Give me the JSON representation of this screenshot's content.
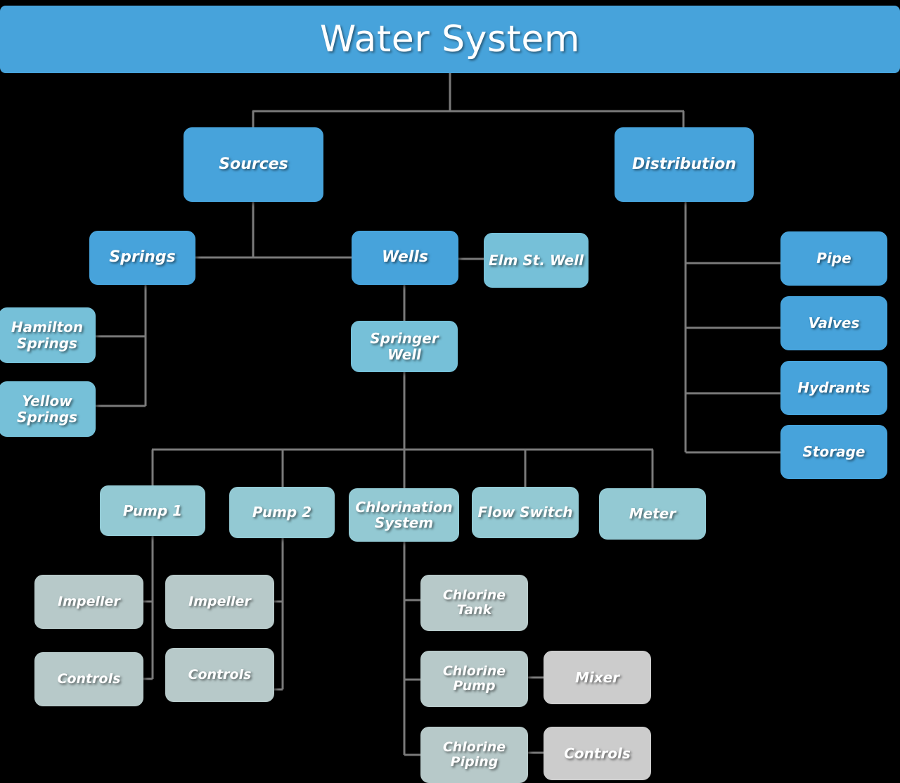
{
  "diagram": {
    "title": "Water System",
    "type": "hierarchy-tree",
    "background_color": "#000000",
    "connector_color": "#7a7a7a",
    "palette": {
      "banner": "#47a3db",
      "tier1": "#47a3db",
      "tier2": "#76c0d8",
      "tier3": "#93c9d3",
      "tier4": "#b7c9c9",
      "tier5": "#cccccc",
      "label": "#ffffff"
    }
  },
  "nodes": {
    "sources": "Sources",
    "distribution": "Distribution",
    "springs": "Springs",
    "wells": "Wells",
    "elm_st_well": "Elm St. Well",
    "hamilton_springs": "Hamilton Springs",
    "yellow_springs": "Yellow Springs",
    "springer_well": "Springer Well",
    "pipe": "Pipe",
    "valves": "Valves",
    "hydrants": "Hydrants",
    "storage": "Storage",
    "pump_1": "Pump 1",
    "pump_2": "Pump 2",
    "chlorination_system": "Chlorination System",
    "flow_switch": "Flow Switch",
    "meter": "Meter",
    "pump1_impeller": "Impeller",
    "pump1_controls": "Controls",
    "pump2_impeller": "Impeller",
    "pump2_controls": "Controls",
    "chlorine_tank": "Chlorine Tank",
    "chlorine_pump": "Chlorine Pump",
    "chlorine_piping": "Chlorine Piping",
    "mixer": "Mixer",
    "chlorine_pump_controls": "Controls"
  },
  "tree": {
    "root": "Water System",
    "children": [
      {
        "label": "Sources",
        "children": [
          {
            "label": "Springs",
            "children": [
              {
                "label": "Hamilton Springs"
              },
              {
                "label": "Yellow Springs"
              }
            ]
          },
          {
            "label": "Wells",
            "children": [
              {
                "label": "Elm St. Well"
              },
              {
                "label": "Springer Well",
                "children": [
                  {
                    "label": "Pump 1",
                    "children": [
                      {
                        "label": "Impeller"
                      },
                      {
                        "label": "Controls"
                      }
                    ]
                  },
                  {
                    "label": "Pump 2",
                    "children": [
                      {
                        "label": "Impeller"
                      },
                      {
                        "label": "Controls"
                      }
                    ]
                  },
                  {
                    "label": "Chlorination System",
                    "children": [
                      {
                        "label": "Chlorine Tank"
                      },
                      {
                        "label": "Chlorine Pump",
                        "children": [
                          {
                            "label": "Mixer"
                          }
                        ]
                      },
                      {
                        "label": "Chlorine Piping",
                        "children": [
                          {
                            "label": "Controls"
                          }
                        ]
                      }
                    ]
                  },
                  {
                    "label": "Flow Switch"
                  },
                  {
                    "label": "Meter"
                  }
                ]
              }
            ]
          }
        ]
      },
      {
        "label": "Distribution",
        "children": [
          {
            "label": "Pipe"
          },
          {
            "label": "Valves"
          },
          {
            "label": "Hydrants"
          },
          {
            "label": "Storage"
          }
        ]
      }
    ]
  }
}
